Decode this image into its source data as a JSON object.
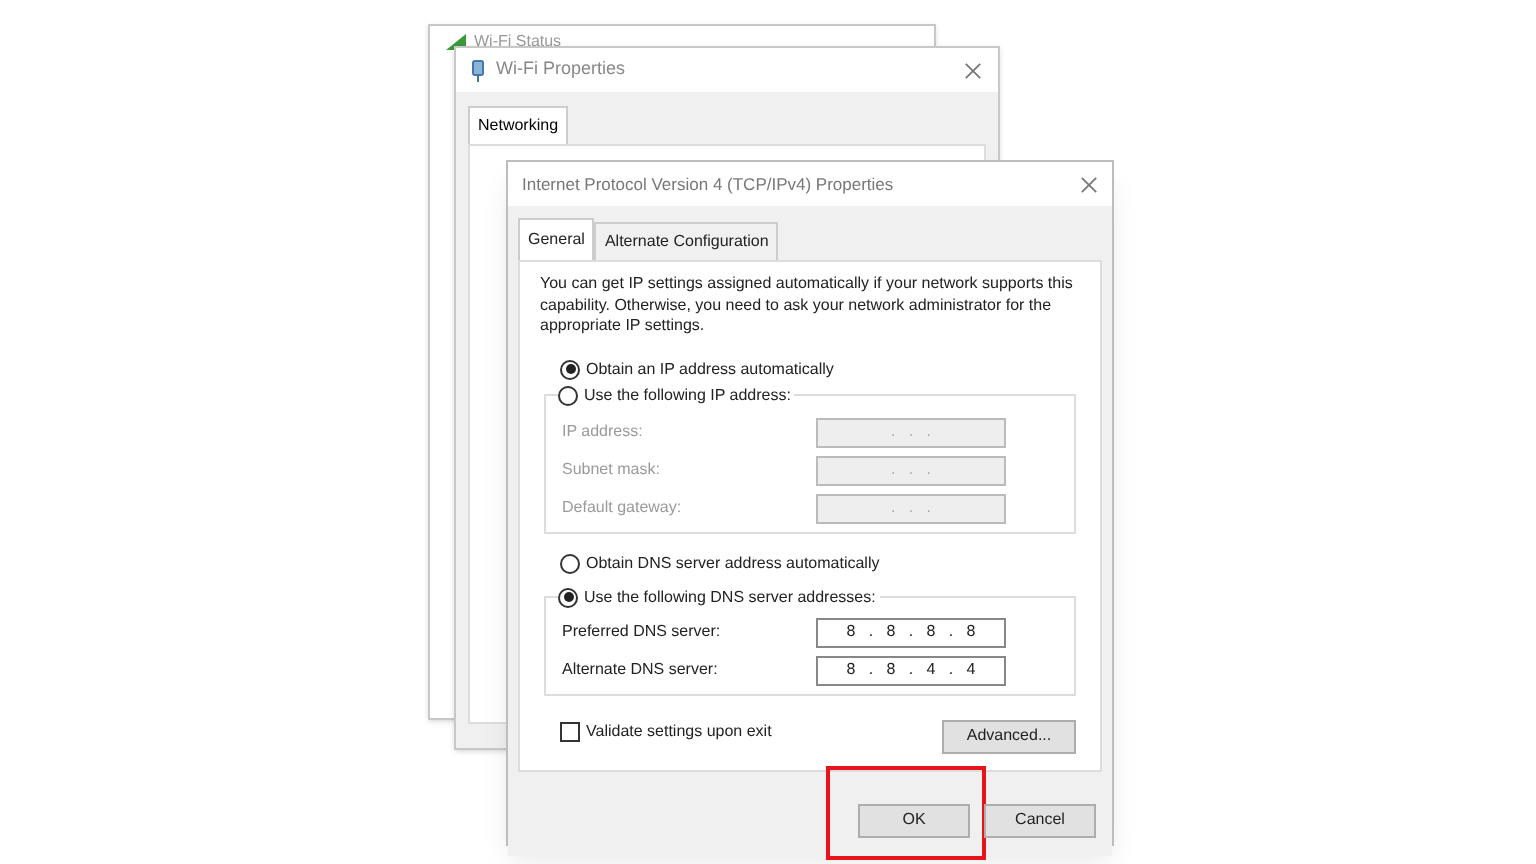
{
  "back_window": {
    "title": "Wi-Fi Status"
  },
  "middle_window": {
    "title": "Wi-Fi Properties",
    "tabs": [
      {
        "label": "Networking",
        "selected": true
      }
    ]
  },
  "dialog": {
    "title": "Internet Protocol Version 4 (TCP/IPv4) Properties",
    "tabs": [
      {
        "label": "General",
        "selected": true
      },
      {
        "label": "Alternate Configuration",
        "selected": false
      }
    ],
    "description": "You can get IP settings assigned automatically if your network supports this capability. Otherwise, you need to ask your network administrator for the appropriate IP settings.",
    "ip_options": [
      {
        "label": "Obtain an IP address automatically",
        "selected": true
      },
      {
        "label": "Use the following IP address:",
        "selected": false
      }
    ],
    "ip_fields": [
      {
        "label": "IP address:",
        "value": ". . .",
        "disabled": true
      },
      {
        "label": "Subnet mask:",
        "value": ". . .",
        "disabled": true
      },
      {
        "label": "Default gateway:",
        "value": ". . .",
        "disabled": true
      }
    ],
    "dns_options": [
      {
        "label": "Obtain DNS server address automatically",
        "selected": false
      },
      {
        "label": "Use the following DNS server addresses:",
        "selected": true
      }
    ],
    "dns_fields": [
      {
        "label": "Preferred DNS server:",
        "value": "8 . 8 . 8 . 8",
        "disabled": false
      },
      {
        "label": "Alternate DNS server:",
        "value": "8 . 8 . 4 . 4",
        "disabled": false
      }
    ],
    "validate": {
      "label": "Validate settings upon exit",
      "checked": false
    },
    "advanced_button": "Advanced...",
    "buttons": [
      {
        "label": "OK",
        "highlighted": true
      },
      {
        "label": "Cancel",
        "highlighted": false
      }
    ]
  }
}
